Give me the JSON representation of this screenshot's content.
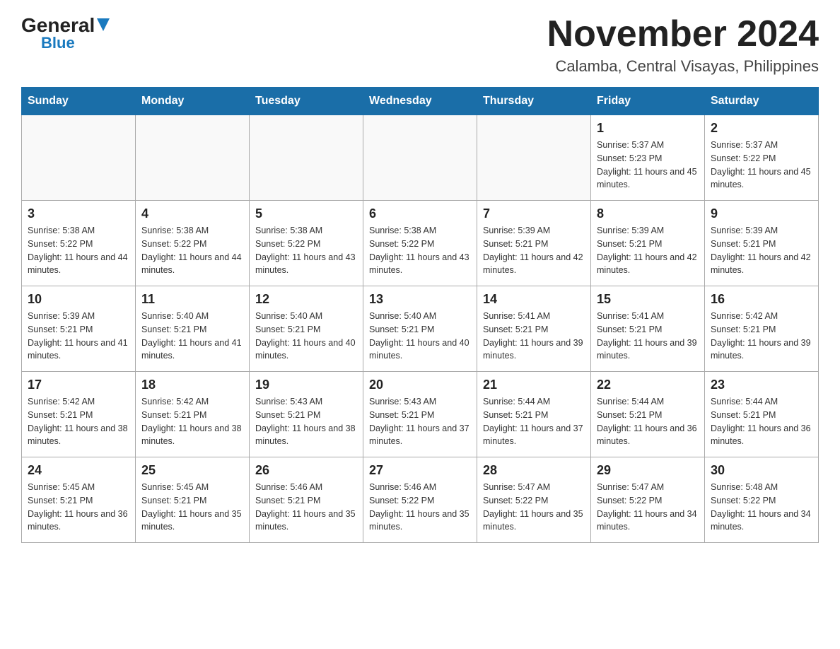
{
  "header": {
    "logo_general": "General",
    "logo_blue": "Blue",
    "title": "November 2024",
    "subtitle": "Calamba, Central Visayas, Philippines"
  },
  "days_of_week": [
    "Sunday",
    "Monday",
    "Tuesday",
    "Wednesday",
    "Thursday",
    "Friday",
    "Saturday"
  ],
  "weeks": [
    [
      {
        "day": "",
        "info": ""
      },
      {
        "day": "",
        "info": ""
      },
      {
        "day": "",
        "info": ""
      },
      {
        "day": "",
        "info": ""
      },
      {
        "day": "",
        "info": ""
      },
      {
        "day": "1",
        "info": "Sunrise: 5:37 AM\nSunset: 5:23 PM\nDaylight: 11 hours and 45 minutes."
      },
      {
        "day": "2",
        "info": "Sunrise: 5:37 AM\nSunset: 5:22 PM\nDaylight: 11 hours and 45 minutes."
      }
    ],
    [
      {
        "day": "3",
        "info": "Sunrise: 5:38 AM\nSunset: 5:22 PM\nDaylight: 11 hours and 44 minutes."
      },
      {
        "day": "4",
        "info": "Sunrise: 5:38 AM\nSunset: 5:22 PM\nDaylight: 11 hours and 44 minutes."
      },
      {
        "day": "5",
        "info": "Sunrise: 5:38 AM\nSunset: 5:22 PM\nDaylight: 11 hours and 43 minutes."
      },
      {
        "day": "6",
        "info": "Sunrise: 5:38 AM\nSunset: 5:22 PM\nDaylight: 11 hours and 43 minutes."
      },
      {
        "day": "7",
        "info": "Sunrise: 5:39 AM\nSunset: 5:21 PM\nDaylight: 11 hours and 42 minutes."
      },
      {
        "day": "8",
        "info": "Sunrise: 5:39 AM\nSunset: 5:21 PM\nDaylight: 11 hours and 42 minutes."
      },
      {
        "day": "9",
        "info": "Sunrise: 5:39 AM\nSunset: 5:21 PM\nDaylight: 11 hours and 42 minutes."
      }
    ],
    [
      {
        "day": "10",
        "info": "Sunrise: 5:39 AM\nSunset: 5:21 PM\nDaylight: 11 hours and 41 minutes."
      },
      {
        "day": "11",
        "info": "Sunrise: 5:40 AM\nSunset: 5:21 PM\nDaylight: 11 hours and 41 minutes."
      },
      {
        "day": "12",
        "info": "Sunrise: 5:40 AM\nSunset: 5:21 PM\nDaylight: 11 hours and 40 minutes."
      },
      {
        "day": "13",
        "info": "Sunrise: 5:40 AM\nSunset: 5:21 PM\nDaylight: 11 hours and 40 minutes."
      },
      {
        "day": "14",
        "info": "Sunrise: 5:41 AM\nSunset: 5:21 PM\nDaylight: 11 hours and 39 minutes."
      },
      {
        "day": "15",
        "info": "Sunrise: 5:41 AM\nSunset: 5:21 PM\nDaylight: 11 hours and 39 minutes."
      },
      {
        "day": "16",
        "info": "Sunrise: 5:42 AM\nSunset: 5:21 PM\nDaylight: 11 hours and 39 minutes."
      }
    ],
    [
      {
        "day": "17",
        "info": "Sunrise: 5:42 AM\nSunset: 5:21 PM\nDaylight: 11 hours and 38 minutes."
      },
      {
        "day": "18",
        "info": "Sunrise: 5:42 AM\nSunset: 5:21 PM\nDaylight: 11 hours and 38 minutes."
      },
      {
        "day": "19",
        "info": "Sunrise: 5:43 AM\nSunset: 5:21 PM\nDaylight: 11 hours and 38 minutes."
      },
      {
        "day": "20",
        "info": "Sunrise: 5:43 AM\nSunset: 5:21 PM\nDaylight: 11 hours and 37 minutes."
      },
      {
        "day": "21",
        "info": "Sunrise: 5:44 AM\nSunset: 5:21 PM\nDaylight: 11 hours and 37 minutes."
      },
      {
        "day": "22",
        "info": "Sunrise: 5:44 AM\nSunset: 5:21 PM\nDaylight: 11 hours and 36 minutes."
      },
      {
        "day": "23",
        "info": "Sunrise: 5:44 AM\nSunset: 5:21 PM\nDaylight: 11 hours and 36 minutes."
      }
    ],
    [
      {
        "day": "24",
        "info": "Sunrise: 5:45 AM\nSunset: 5:21 PM\nDaylight: 11 hours and 36 minutes."
      },
      {
        "day": "25",
        "info": "Sunrise: 5:45 AM\nSunset: 5:21 PM\nDaylight: 11 hours and 35 minutes."
      },
      {
        "day": "26",
        "info": "Sunrise: 5:46 AM\nSunset: 5:21 PM\nDaylight: 11 hours and 35 minutes."
      },
      {
        "day": "27",
        "info": "Sunrise: 5:46 AM\nSunset: 5:22 PM\nDaylight: 11 hours and 35 minutes."
      },
      {
        "day": "28",
        "info": "Sunrise: 5:47 AM\nSunset: 5:22 PM\nDaylight: 11 hours and 35 minutes."
      },
      {
        "day": "29",
        "info": "Sunrise: 5:47 AM\nSunset: 5:22 PM\nDaylight: 11 hours and 34 minutes."
      },
      {
        "day": "30",
        "info": "Sunrise: 5:48 AM\nSunset: 5:22 PM\nDaylight: 11 hours and 34 minutes."
      }
    ]
  ]
}
